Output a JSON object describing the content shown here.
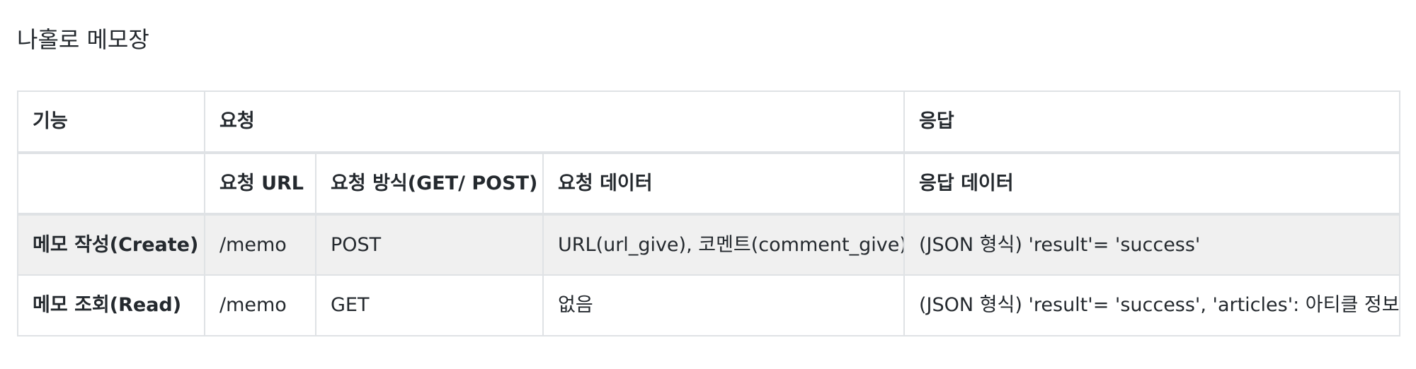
{
  "page": {
    "title": "나홀로 메모장"
  },
  "table": {
    "header_row_1": {
      "feature": "기능",
      "request": "요청",
      "response": "응답"
    },
    "header_row_2": {
      "feature": "",
      "request_url": "요청 URL",
      "request_method": "요청 방식(GET/ POST)",
      "request_data": "요청 데이터",
      "response_data": "응답 데이터"
    },
    "rows": [
      {
        "feature": "메모 작성(Create)",
        "url": "/memo",
        "method": "POST",
        "request_data": "URL(url_give), 코멘트(comment_give)",
        "response_data": "(JSON 형식) 'result'= 'success'"
      },
      {
        "feature": "메모 조회(Read)",
        "url": "/memo",
        "method": "GET",
        "request_data": "없음",
        "response_data": "(JSON 형식) 'result'= 'success', 'articles': 아티클 정보"
      }
    ]
  },
  "colors": {
    "text": "#24292e",
    "border": "#dfe2e5",
    "shaded_row": "#f0f0f0",
    "background": "#ffffff"
  }
}
